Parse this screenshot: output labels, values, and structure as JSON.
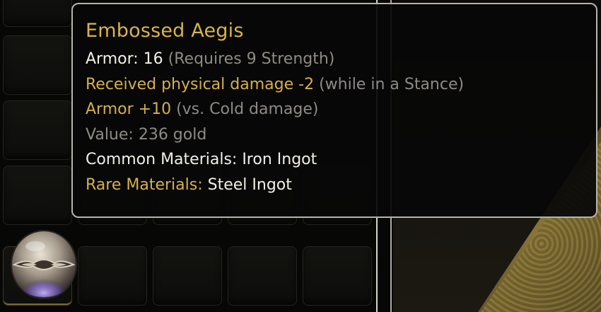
{
  "colors": {
    "title_gold": "#d9b44a",
    "stat_white": "#f2efe6",
    "affix_gold": "#d6b04a",
    "note_grey": "#8e8b84",
    "tooltip_border": "#b7b4ab"
  },
  "inventory": {
    "selected_item_icon": "round-shield-icon"
  },
  "tooltip": {
    "item_name": "Embossed Aegis",
    "armor": {
      "label": "Armor: 16",
      "requirement": "(Requires 9 Strength)"
    },
    "affix_1": {
      "text": "Received physical damage -2",
      "condition": "(while in a Stance)"
    },
    "affix_2": {
      "text": "Armor +10",
      "condition": "(vs. Cold damage)"
    },
    "value": "Value: 236 gold",
    "common_materials": "Common Materials: Iron Ingot",
    "rare_materials": {
      "label": "Rare Materials:",
      "value": "Steel Ingot"
    }
  }
}
